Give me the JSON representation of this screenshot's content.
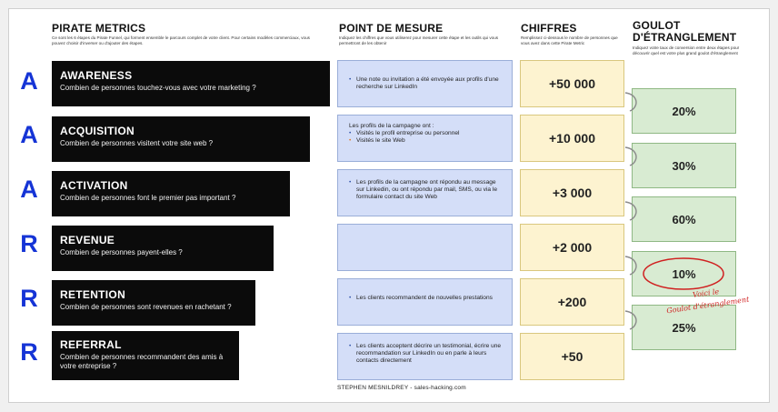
{
  "headers": {
    "pirate": "PIRATE METRICS",
    "pirate_sub": "Ce sont les 6 étapes du Pirate Funnel, qui forment ensemble le parcours complet de votre client. Pour certains modèles commerciaux, vous pouvez choisir d'inverser ou d'ajouter des étapes.",
    "mesure": "POINT DE MESURE",
    "mesure_sub": "Indiquez les chiffres que vous utiliserez pour mesurer cette étape et les outils qui vous permettront de les obtenir",
    "chiffres": "CHIFFRES",
    "chiffres_sub": "Remplissez ci-dessous le nombre de personnes que vous avez dans cette Pirate Metric",
    "goulot_line1": "GOULOT",
    "goulot_line2": "D'ÉTRANGLEMENT",
    "goulot_sub": "Indiquez votre taux de conversion entre deux étapes pour découvrir quel est votre plus grand goulot d'étranglement"
  },
  "stages": [
    {
      "letter": "A",
      "title": "AWARENESS",
      "question": "Combien de personnes touchez-vous avec votre marketing ?",
      "chiffre": "+50 000",
      "mesure": [
        {
          "text": "Une note ou invitation a été envoyée aux profils d'une recherche sur LinkedIn",
          "bullet": true
        }
      ]
    },
    {
      "letter": "A",
      "title": "ACQUISITION",
      "question": "Combien de personnes visitent votre site web ?",
      "chiffre": "+10 000",
      "mesure": [
        {
          "text": "Les profils de la campagne ont :",
          "bullet": false
        },
        {
          "text": "Visités le profil entreprise ou personnel",
          "bullet": true
        },
        {
          "text": "Visités le site Web",
          "bullet": true
        }
      ]
    },
    {
      "letter": "A",
      "title": "ACTIVATION",
      "question": "Combien de personnes font le premier pas important ?",
      "chiffre": "+3 000",
      "mesure": [
        {
          "text": "Les profils de la campagne ont répondu au message sur Linkedin, ou ont répondu par mail, SMS, ou via le formulaire contact du site Web",
          "bullet": true
        }
      ]
    },
    {
      "letter": "R",
      "title": "REVENUE",
      "question": "Combien de personnes payent-elles ?",
      "chiffre": "+2 000",
      "mesure": []
    },
    {
      "letter": "R",
      "title": "RETENTION",
      "question": "Combien de personnes sont revenues en rachetant ?",
      "chiffre": "+200",
      "mesure": [
        {
          "text": "Les clients recommandent de nouvelles prestations",
          "bullet": true
        }
      ]
    },
    {
      "letter": "R",
      "title": "REFERRAL",
      "question": "Combien de personnes recommandent des amis à votre entreprise ?",
      "chiffre": "+50",
      "mesure": [
        {
          "text": "Les clients acceptent décrire un testimonial, écrire une recommandation sur LinkedIn ou en parle à leurs contacts directement",
          "bullet": true
        }
      ]
    }
  ],
  "goulots": [
    "20%",
    "30%",
    "60%",
    "10%",
    "25%"
  ],
  "annotation_line1": "Voici le",
  "annotation_line2": "Goulot d'étranglement",
  "footer": "STEPHEN MESNILDREY - sales-hacking.com",
  "colors": {
    "letter": "#1534d6",
    "bar": "#0b0b0b",
    "mesure": "#d4def8",
    "chiffre": "#fdf3d0",
    "goulot": "#d8ebd2",
    "annotation": "#d02020"
  }
}
